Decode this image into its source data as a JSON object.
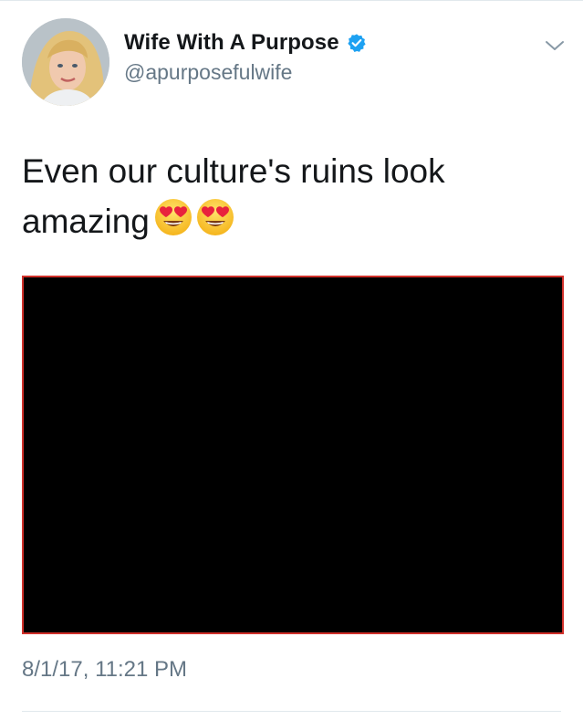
{
  "tweet": {
    "author": {
      "display_name": "Wife With A Purpose",
      "handle": "@apurposefulwife",
      "verified": true,
      "avatar_icon": "profile-photo"
    },
    "text": "Even our culture's ruins look amazing",
    "emojis": [
      "heart-eyes-emoji",
      "heart-eyes-emoji"
    ],
    "media": {
      "type": "image",
      "content": "redacted-black"
    },
    "timestamp": "8/1/17, 11:21 PM",
    "menu_icon": "chevron-down-icon"
  },
  "colors": {
    "text": "#14171a",
    "secondary": "#657786",
    "verified": "#1da1f2",
    "media_border": "#d0302a",
    "divider": "#e1e8ed"
  }
}
